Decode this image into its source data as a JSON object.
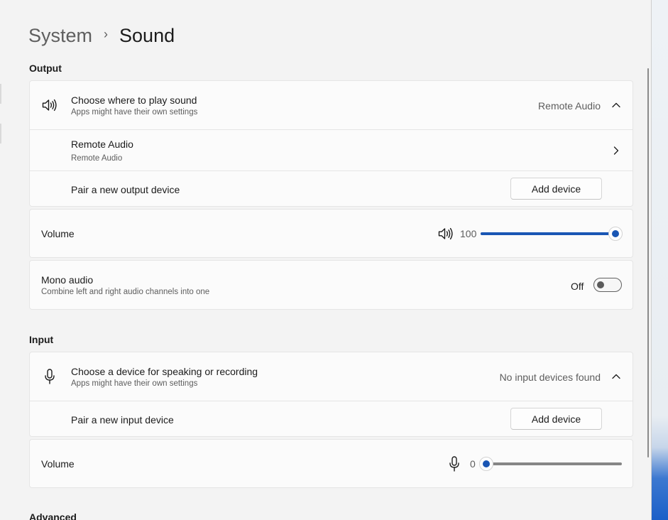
{
  "breadcrumb": {
    "parent": "System",
    "separator": "›",
    "current": "Sound"
  },
  "output": {
    "section_label": "Output",
    "choose": {
      "title": "Choose where to play sound",
      "subtitle": "Apps might have their own settings",
      "selected": "Remote Audio",
      "icon": "speaker-icon",
      "expanded": true
    },
    "device": {
      "title": "Remote Audio",
      "subtitle": "Remote Audio",
      "icon": "chevron-right-icon"
    },
    "pair": {
      "label": "Pair a new output device",
      "button": "Add device"
    },
    "volume": {
      "label": "Volume",
      "value": "100",
      "level": 100,
      "icon": "speaker-icon"
    },
    "mono": {
      "title": "Mono audio",
      "subtitle": "Combine left and right audio channels into one",
      "state": "Off",
      "on": false
    }
  },
  "input": {
    "section_label": "Input",
    "choose": {
      "title": "Choose a device for speaking or recording",
      "subtitle": "Apps might have their own settings",
      "selected": "No input devices found",
      "icon": "microphone-icon",
      "expanded": true
    },
    "pair": {
      "label": "Pair a new input device",
      "button": "Add device"
    },
    "volume": {
      "label": "Volume",
      "value": "0",
      "level": 0,
      "icon": "microphone-icon"
    }
  },
  "advanced": {
    "section_label": "Advanced"
  },
  "colors": {
    "accent": "#1a56b4",
    "background": "#f3f3f3",
    "card": "#fbfbfb"
  }
}
